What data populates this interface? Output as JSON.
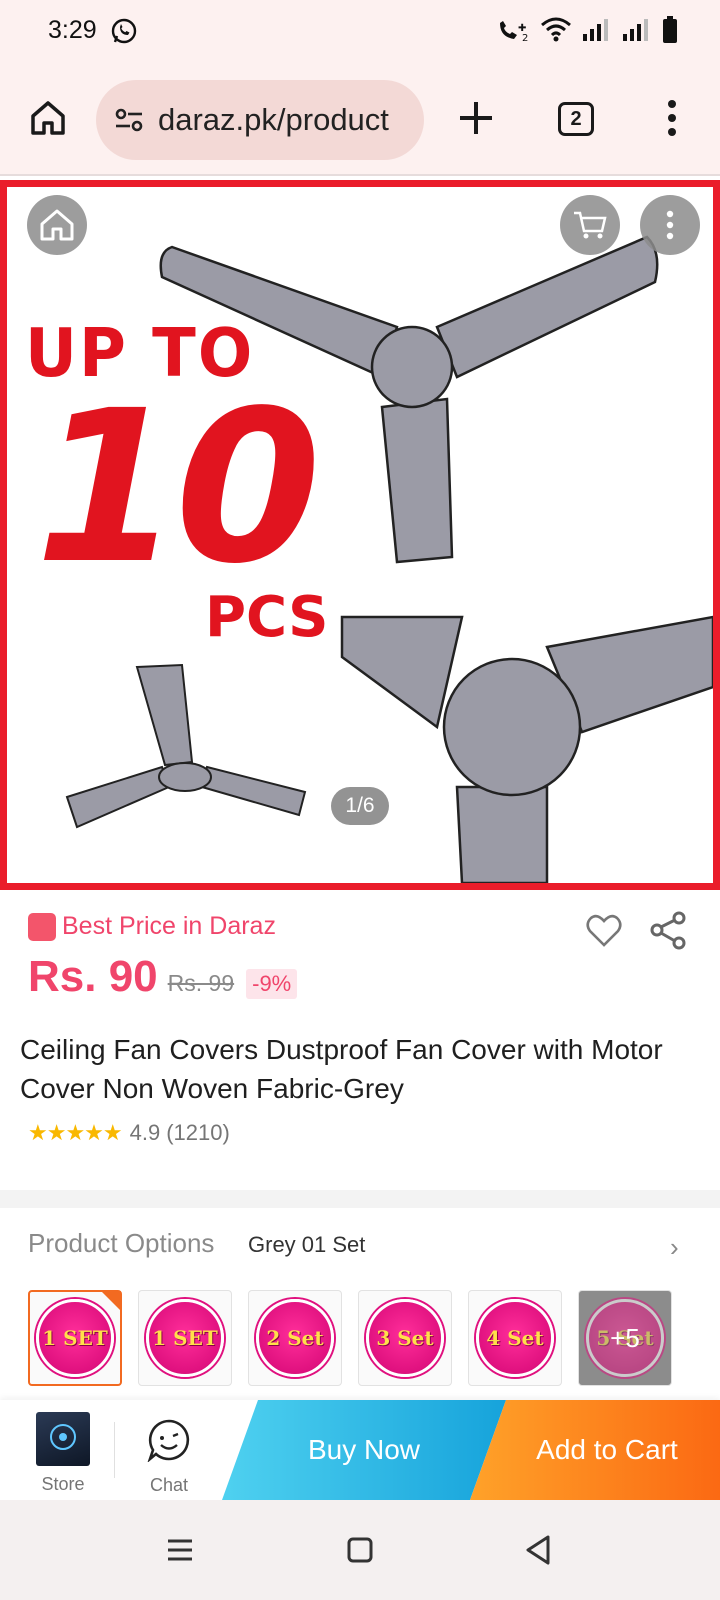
{
  "status_bar": {
    "time": "3:29"
  },
  "browser": {
    "url": "daraz.pk/product",
    "tab_count": "2"
  },
  "hero": {
    "promo_line1": "UP TO",
    "promo_line2": "10",
    "promo_line3": "PCS",
    "image_counter": "1/6"
  },
  "product": {
    "badge": "Best Price in Daraz",
    "price": "Rs. 90",
    "original_price": "Rs. 99",
    "discount": "-9%",
    "title": "Ceiling Fan Covers Dustproof Fan Cover with Motor Cover Non Woven Fabric-Grey",
    "stars": "★★★★★",
    "rating": "4.9",
    "review_count": "(1210)"
  },
  "options": {
    "label": "Product Options",
    "selected": "Grey 01 Set",
    "swatches": [
      {
        "label": "1 SET"
      },
      {
        "label": "1 SET"
      },
      {
        "label": "2 Set"
      },
      {
        "label": "3 Set"
      },
      {
        "label": "4 Set"
      },
      {
        "label": "5 Set"
      }
    ],
    "more_count": "+5"
  },
  "actions": {
    "store_label": "Store",
    "chat_label": "Chat",
    "buy_now": "Buy Now",
    "add_to_cart": "Add to Cart"
  },
  "colors": {
    "brand_pink": "#f0456b",
    "promo_red": "#e1141f",
    "buy_now_blue": "#16a3db",
    "add_cart_orange": "#fb6913",
    "selected_border": "#f26a21"
  }
}
